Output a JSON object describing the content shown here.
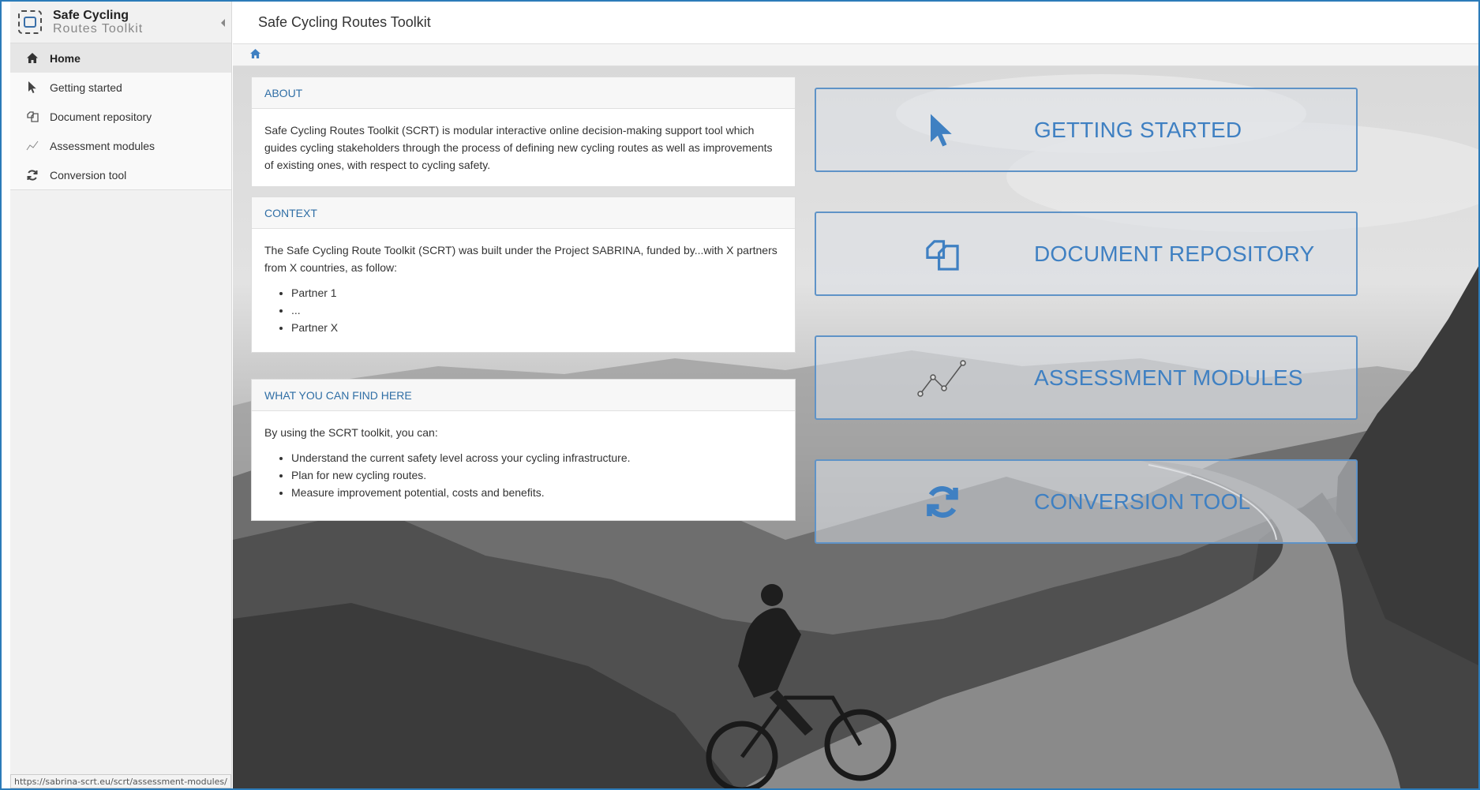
{
  "app": {
    "brand_title": "Safe Cycling",
    "brand_subtitle": "Routes Toolkit",
    "header_title": "Safe Cycling Routes Toolkit",
    "status_url": "https://sabrina-scrt.eu/scrt/assessment-modules/"
  },
  "sidebar": {
    "items": [
      {
        "label": "Home",
        "icon": "home-icon",
        "active": true
      },
      {
        "label": "Getting started",
        "icon": "cursor-icon",
        "active": false
      },
      {
        "label": "Document repository",
        "icon": "documents-icon",
        "active": false
      },
      {
        "label": "Assessment modules",
        "icon": "line-chart-icon",
        "active": false
      },
      {
        "label": "Conversion tool",
        "icon": "refresh-icon",
        "active": false
      }
    ]
  },
  "breadcrumb": {
    "icon": "home-icon"
  },
  "cards": {
    "about": {
      "title": "ABOUT",
      "text": "Safe Cycling Routes Toolkit (SCRT) is modular interactive online decision-making support tool which guides cycling stakeholders through the process of defining new cycling routes as well as improvements of existing ones, with respect to cycling safety."
    },
    "context": {
      "title": "CONTEXT",
      "text": "The Safe Cycling Route Toolkit (SCRT) was built under the Project SABRINA, funded by...with X partners from X countries, as follow:",
      "list": [
        "Partner 1",
        "...",
        "Partner X"
      ]
    },
    "find": {
      "title": "WHAT YOU CAN FIND HERE",
      "text": "By using the SCRT toolkit, you can:",
      "list": [
        "Understand the current safety level across your cycling infrastructure.",
        "Plan for new cycling routes.",
        "Measure improvement potential, costs and benefits."
      ]
    }
  },
  "tiles": [
    {
      "label": "GETTING STARTED",
      "icon": "cursor-icon"
    },
    {
      "label": "DOCUMENT REPOSITORY",
      "icon": "documents-icon"
    },
    {
      "label": "ASSESSMENT MODULES",
      "icon": "line-chart-icon"
    },
    {
      "label": "CONVERSION TOOL",
      "icon": "refresh-icon"
    }
  ],
  "colors": {
    "accent": "#3f80c2",
    "frame": "#2b7bb9",
    "card_header_text": "#2f6ea5"
  }
}
